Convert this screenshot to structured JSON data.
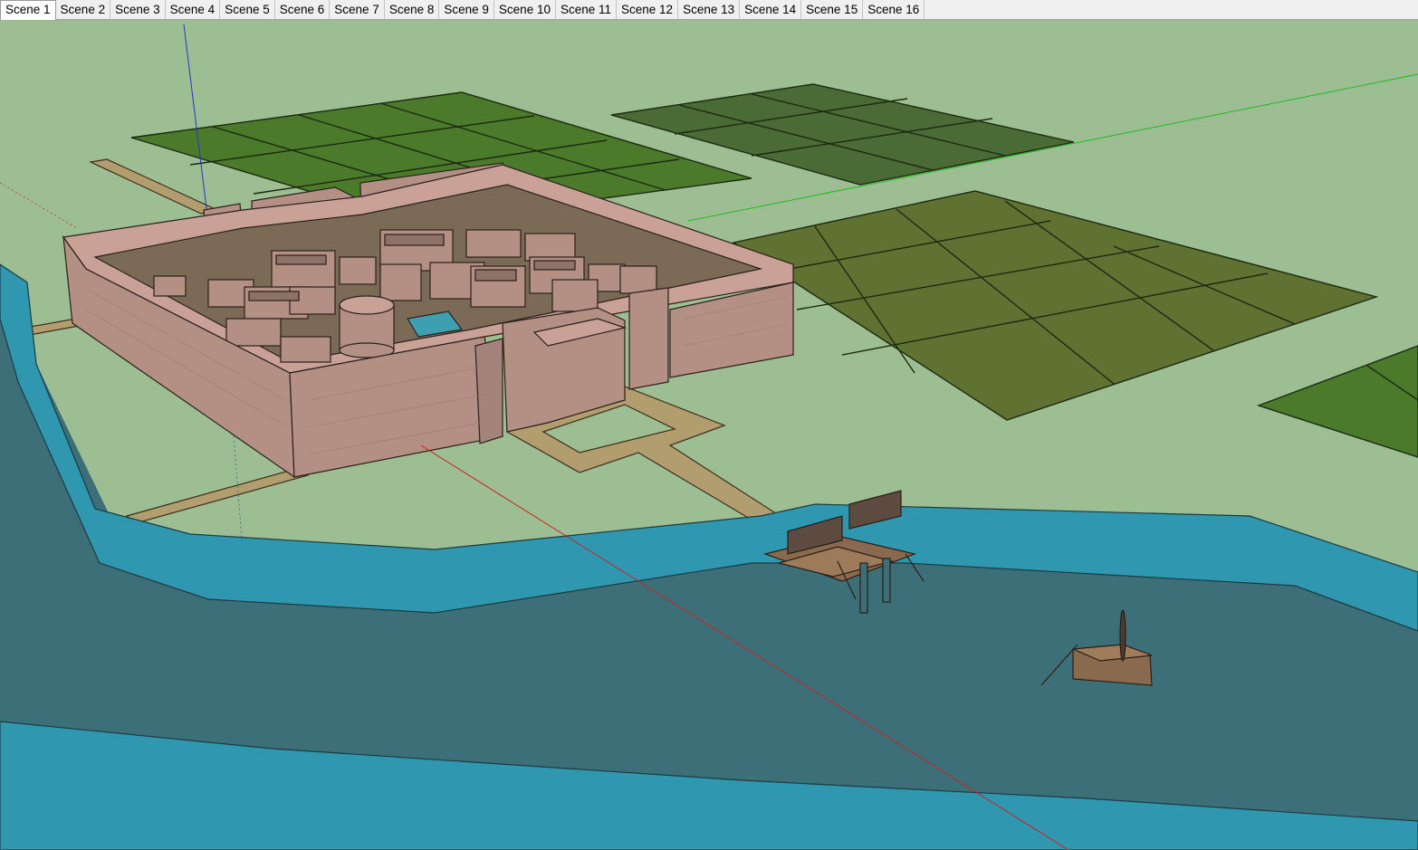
{
  "scene_tabs": {
    "active_index": 0,
    "items": [
      {
        "label": "Scene 1"
      },
      {
        "label": "Scene 2"
      },
      {
        "label": "Scene 3"
      },
      {
        "label": "Scene 4"
      },
      {
        "label": "Scene 5"
      },
      {
        "label": "Scene 6"
      },
      {
        "label": "Scene 7"
      },
      {
        "label": "Scene 8"
      },
      {
        "label": "Scene 9"
      },
      {
        "label": "Scene 10"
      },
      {
        "label": "Scene 11"
      },
      {
        "label": "Scene 12"
      },
      {
        "label": "Scene 13"
      },
      {
        "label": "Scene 14"
      },
      {
        "label": "Scene 15"
      },
      {
        "label": "Scene 16"
      }
    ]
  },
  "colors": {
    "ground": "#9dbe93",
    "river": "#3d6f78",
    "river_bank": "#2f98b0",
    "wall_face": "#b48f84",
    "wall_top": "#c9a196",
    "field_dark": "#4c7a2b",
    "field_olive": "#5f7232",
    "field_muted": "#4a6b35",
    "road": "#b29d6e",
    "raft_wood": "#8a6a4e",
    "axis_red": "#cc2222",
    "axis_green": "#22bb22",
    "axis_blue": "#2233cc"
  }
}
